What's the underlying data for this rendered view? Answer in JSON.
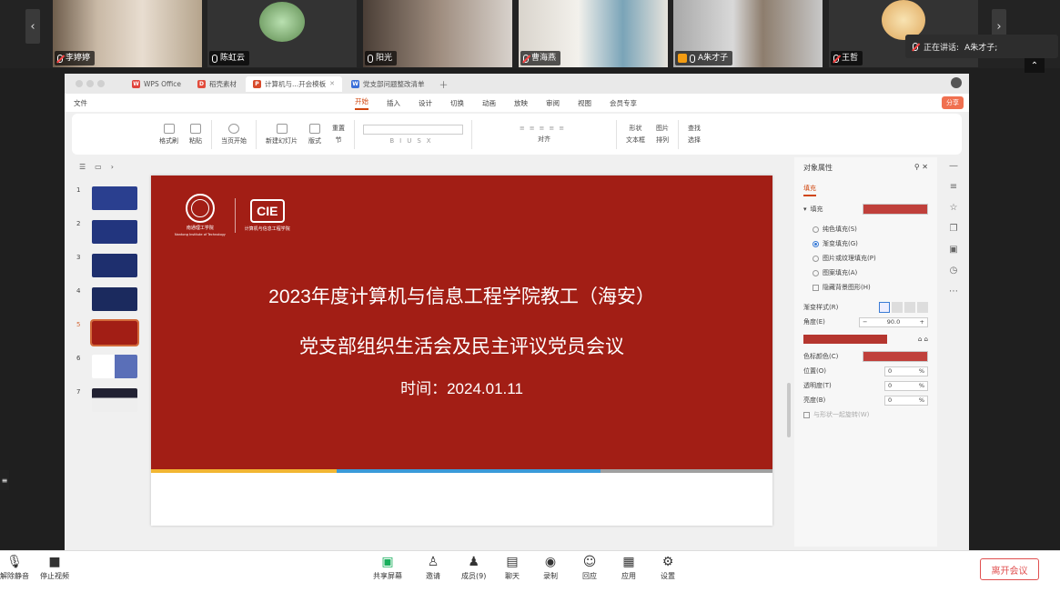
{
  "participants": [
    {
      "name": "李婷婷",
      "muted": true
    },
    {
      "name": "陈虹云",
      "muted": false
    },
    {
      "name": "阳光",
      "muted": false
    },
    {
      "name": "曹海燕",
      "muted": true
    },
    {
      "name": "A朱才子",
      "muted": false,
      "active": true
    },
    {
      "name": "王哲",
      "muted": true
    }
  ],
  "speaking": {
    "label": "正在讲话:",
    "name": "A朱才子;"
  },
  "tabs": [
    {
      "label": "WPS Office",
      "icon": "wps-icon"
    },
    {
      "label": "稻壳素材",
      "icon": "docer-icon"
    },
    {
      "label": "计算机与...开会模板",
      "icon": "ppt-icon",
      "selected": true
    },
    {
      "label": "党支部问题整改清单",
      "icon": "doc-icon"
    }
  ],
  "menu": {
    "file": "文件",
    "items": [
      "开始",
      "插入",
      "设计",
      "切换",
      "动画",
      "放映",
      "审阅",
      "视图",
      "会员专享"
    ],
    "share": "分享"
  },
  "ribbon": {
    "format_painter": "格式刷",
    "paste": "粘贴",
    "start_show": "当页开始",
    "new_slide": "新建幻灯片",
    "layout": "版式",
    "reset": "重置",
    "section": "节",
    "shape": "形状",
    "image": "图片",
    "textbox": "文本框",
    "arrange": "排列",
    "find": "查找",
    "select": "选择",
    "align": "对齐"
  },
  "thumbnails": [
    "1",
    "2",
    "3",
    "4",
    "5",
    "6",
    "7"
  ],
  "slide": {
    "title_line1": "2023年度计算机与信息工程学院教工（海安）",
    "title_line2": "党支部组织生活会及民主评议党员会议",
    "date": "时间：2024.01.11",
    "logo_text": "CIE",
    "school_name": "南通理工学院",
    "school_en": "Nantong Institute of Technology",
    "college_name": "计算机与信息工程学院"
  },
  "props": {
    "title": "对象属性",
    "tab": "填充",
    "fill_label": "填充",
    "options": [
      "纯色填充(S)",
      "渐变填充(G)",
      "图片或纹理填充(P)",
      "图案填充(A)"
    ],
    "hide_bg": "隐藏背景图形(H)",
    "gradient_style": "渐变样式(R)",
    "angle_label": "角度(E)",
    "angle_value": "90.0",
    "stop_color": "色标颜色(C)",
    "position": "位置(O)",
    "transparency": "透明度(T)",
    "brightness": "亮度(B)",
    "rotate": "与形状一起旋转(W)",
    "zero": "0",
    "pct": "%"
  },
  "bottom": {
    "mute": "解除静音",
    "video": "停止视频",
    "share": "共享屏幕",
    "invite": "邀请",
    "members": "成员(9)",
    "chat": "聊天",
    "record": "录制",
    "reaction": "回应",
    "apps": "应用",
    "settings": "设置",
    "leave": "离开会议"
  },
  "colors": {
    "slide_red": "#a21e15",
    "accent": "#d0460e",
    "leave": "#e05050"
  }
}
